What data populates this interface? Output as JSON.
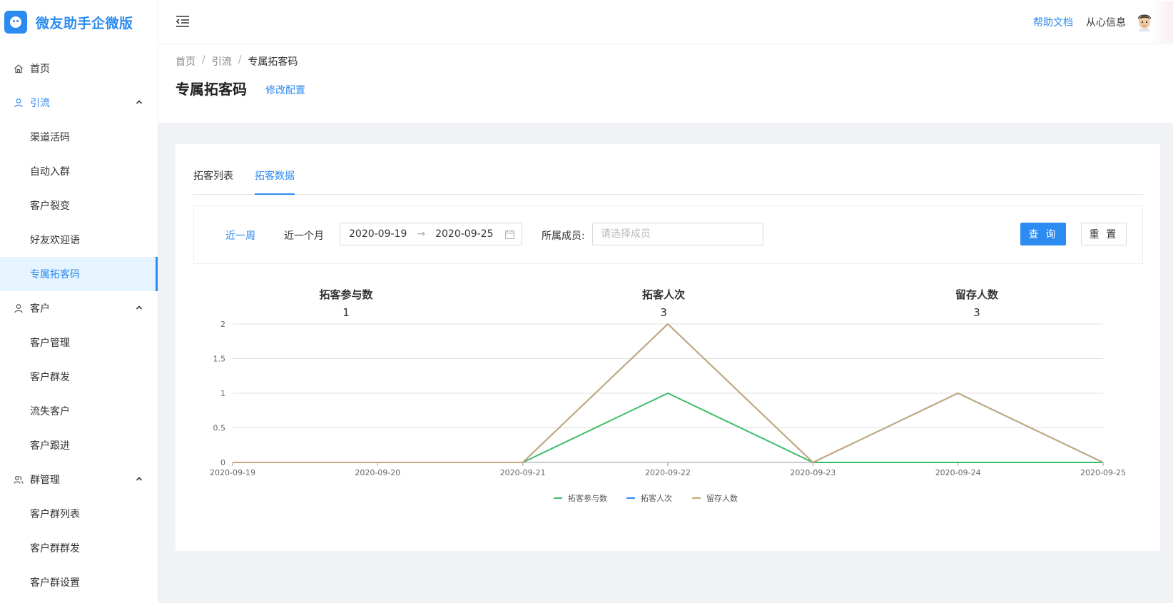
{
  "brand": {
    "title": "微友助手企微版"
  },
  "sidebar": {
    "items": [
      {
        "label": "首页",
        "icon": "home-icon"
      },
      {
        "label": "引流",
        "icon": "user-icon",
        "children": [
          "渠道活码",
          "自动入群",
          "客户裂变",
          "好友欢迎语",
          "专属拓客码"
        ],
        "selected": "专属拓客码"
      },
      {
        "label": "客户",
        "icon": "user-icon",
        "children": [
          "客户管理",
          "客户群发",
          "流失客户",
          "客户跟进"
        ]
      },
      {
        "label": "群管理",
        "icon": "group-icon",
        "children": [
          "客户群列表",
          "客户群群发",
          "客户群设置"
        ]
      }
    ]
  },
  "header": {
    "help_label": "帮助文档",
    "user_name": "从心信息"
  },
  "breadcrumb": {
    "items": [
      "首页",
      "引流",
      "专属拓客码"
    ],
    "separator": "/"
  },
  "page": {
    "title": "专属拓客码",
    "action_label": "修改配置"
  },
  "tabs": [
    {
      "label": "拓客列表",
      "active": false
    },
    {
      "label": "拓客数据",
      "active": true
    }
  ],
  "filter": {
    "quick_week": "近一周",
    "quick_month": "近一个月",
    "date_start": "2020-09-19",
    "date_end": "2020-09-25",
    "range_arrow": "→",
    "member_label": "所属成员:",
    "member_placeholder": "请选择成员",
    "query_label": "查 询",
    "reset_label": "重 置"
  },
  "stats": [
    {
      "title": "拓客参与数",
      "value": "1"
    },
    {
      "title": "拓客人次",
      "value": "3"
    },
    {
      "title": "留存人数",
      "value": "3"
    }
  ],
  "chart_data": {
    "type": "line",
    "x": [
      "2020-09-19",
      "2020-09-20",
      "2020-09-21",
      "2020-09-22",
      "2020-09-23",
      "2020-09-24",
      "2020-09-25"
    ],
    "yticks": [
      0,
      0.5,
      1,
      1.5,
      2
    ],
    "ylim": [
      0,
      2
    ],
    "grid": true,
    "legend_position": "bottom",
    "series": [
      {
        "name": "拓客参与数",
        "color": "#3dbd6b",
        "values": [
          0,
          0,
          0,
          1,
          0,
          0,
          0
        ]
      },
      {
        "name": "拓客人次",
        "color": "#2b8bf0",
        "values": [
          0,
          0,
          0,
          2,
          0,
          1,
          0
        ]
      },
      {
        "name": "留存人数",
        "color": "#c8a97a",
        "values": [
          0,
          0,
          0,
          2,
          0,
          1,
          0
        ]
      }
    ]
  },
  "colors": {
    "accent": "#2b8bf0",
    "selected_bg": "#e6f4ff"
  }
}
